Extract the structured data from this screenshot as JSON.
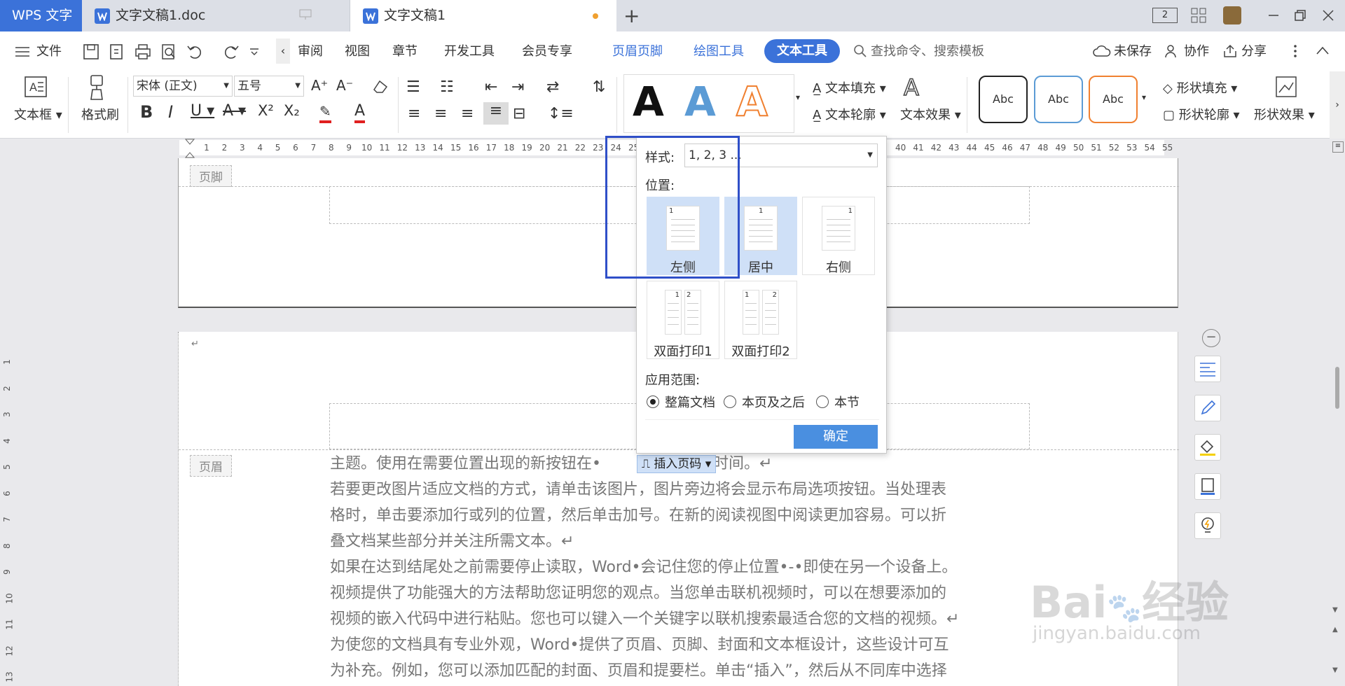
{
  "titlebar": {
    "app_name": "WPS 文字",
    "tabs": [
      {
        "label": "文字文稿1.doc"
      },
      {
        "label": "文字文稿1"
      }
    ],
    "new_tab": "+",
    "page_indicator": "2"
  },
  "menu": {
    "file": "文件",
    "items": [
      "审阅",
      "视图",
      "章节",
      "开发工具",
      "会员专享",
      "页眉页脚",
      "绘图工具"
    ],
    "active_tab": "文本工具",
    "search_placeholder": "查找命令、搜索模板",
    "unsaved": "未保存",
    "collab": "协作",
    "share": "分享"
  },
  "ribbon": {
    "textbox": "文本框",
    "format_painter": "格式刷",
    "font_name": "宋体 (正文)",
    "font_size": "五号",
    "text_fill": "文本填充",
    "text_outline": "文本轮廓",
    "text_effect": "文本效果",
    "shape_fill": "形状填充",
    "shape_outline": "形状轮廓",
    "shape_effect": "形状效果",
    "style_sample": "Abc",
    "art_sample": "A"
  },
  "ruler": {
    "numbers": [
      "1",
      "2",
      "3",
      "4",
      "5",
      "6",
      "7",
      "8",
      "9",
      "10",
      "11",
      "12",
      "13",
      "14",
      "15",
      "16",
      "17",
      "18",
      "19",
      "20",
      "21",
      "22",
      "23",
      "24",
      "25",
      "40",
      "41",
      "42",
      "43",
      "44",
      "45",
      "46",
      "47",
      "48",
      "49",
      "50",
      "51",
      "52",
      "53",
      "54",
      "55"
    ],
    "vertical": [
      "1",
      "2",
      "3",
      "4",
      "5",
      "6",
      "7",
      "8",
      "9",
      "10",
      "11",
      "12",
      "13"
    ]
  },
  "page": {
    "footer_tag": "页脚",
    "header_tag": "页眉",
    "insert_page_btn": "插入页码",
    "lines": [
      "主题。使用在需要位置出现的新按钮在•",
      "保存时间。↵",
      "若要更改图片适应文档的方式，请单击该图片，图片旁边将会显示布局选项按钮。当处理表",
      "格时，单击要添加行或列的位置，然后单击加号。在新的阅读视图中阅读更加容易。可以折",
      "叠文档某些部分并关注所需文本。↵",
      "如果在达到结尾处之前需要停止读取，Word•会记住您的停止位置•-•即使在另一个设备上。",
      "视频提供了功能强大的方法帮助您证明您的观点。当您单击联机视频时，可以在想要添加的",
      "视频的嵌入代码中进行粘贴。您也可以键入一个关键字以联机搜索最适合您的文档的视频。↵",
      "为使您的文档具有专业外观，Word•提供了页眉、页脚、封面和文本框设计，这些设计可互",
      "为补充。例如，您可以添加匹配的封面、页眉和提要栏。单击“插入”，然后从不同库中选择"
    ]
  },
  "popup": {
    "style_label": "样式:",
    "style_value": "1, 2, 3 ...",
    "position_label": "位置:",
    "positions": [
      "左侧",
      "居中",
      "右侧",
      "双面打印1",
      "双面打印2"
    ],
    "scope_label": "应用范围:",
    "scopes": [
      "整篇文档",
      "本页及之后",
      "本节"
    ],
    "selected_scope": "整篇文档",
    "ok": "确定"
  },
  "watermark": {
    "brand": "Bai",
    "brand2": "经验",
    "url": "jingyan.baidu.com"
  }
}
